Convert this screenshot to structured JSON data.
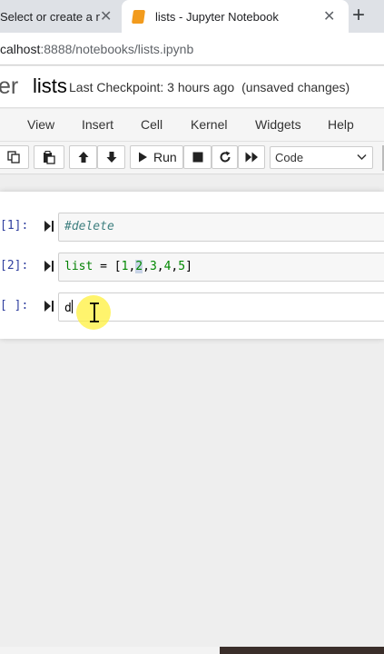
{
  "browser": {
    "tabs": [
      {
        "title": "Select or create a n",
        "active": false
      },
      {
        "title": "lists - Jupyter Notebook",
        "active": true
      }
    ],
    "close_glyph": "✕",
    "new_tab_glyph": "+",
    "url_host": "calhost",
    "url_rest": ":8888/notebooks/lists.ipynb"
  },
  "header": {
    "logo_text": "er",
    "notebook_name": "lists",
    "checkpoint": "Last Checkpoint: 3 hours ago",
    "unsaved": "(unsaved changes)"
  },
  "menu": [
    "View",
    "Insert",
    "Cell",
    "Kernel",
    "Widgets",
    "Help"
  ],
  "toolbar": {
    "run_label": "Run",
    "cell_type": "Code"
  },
  "cells": [
    {
      "prompt": "[1]:",
      "code": "#delete"
    },
    {
      "prompt": "[2]:",
      "code": "list = [1,2,3,4,5]"
    },
    {
      "prompt": "[ ]:",
      "code": "d"
    }
  ],
  "colors": {
    "prompt": "#303f9f",
    "accent_orange": "#f29b1d"
  }
}
